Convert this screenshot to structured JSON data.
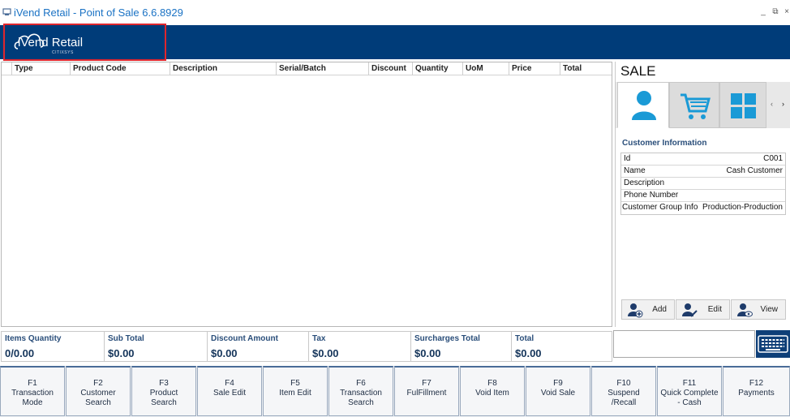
{
  "window": {
    "title": "iVend Retail - Point of Sale 6.6.8929"
  },
  "brand": {
    "name": "iVend Retail",
    "tagline": "CITIXSYS",
    "header_color": "#003c79"
  },
  "grid": {
    "columns": [
      "Type",
      "Product Code",
      "Description",
      "Serial/Batch",
      "Discount",
      "Quantity",
      "UoM",
      "Price",
      "Total"
    ]
  },
  "sale_panel": {
    "title": "SALE",
    "tabs": [
      {
        "icon": "customer-icon",
        "active": true
      },
      {
        "icon": "cart-icon",
        "active": false
      },
      {
        "icon": "grid-icon",
        "active": false
      }
    ],
    "customer_section_title": "Customer Information",
    "customer_fields": [
      {
        "label": "Id",
        "value": "C001"
      },
      {
        "label": "Name",
        "value": "Cash Customer"
      },
      {
        "label": "Description",
        "value": ""
      },
      {
        "label": "Phone Number",
        "value": ""
      },
      {
        "label": "Customer Group Info",
        "value": "Production-Production"
      }
    ],
    "actions": [
      {
        "label": "Add",
        "icon": "add-user-icon"
      },
      {
        "label": "Edit",
        "icon": "edit-user-icon"
      },
      {
        "label": "View",
        "icon": "view-user-icon"
      }
    ]
  },
  "totals": [
    {
      "label": "Items Quantity",
      "value": "0/0.00"
    },
    {
      "label": "Sub Total",
      "value": "$0.00"
    },
    {
      "label": "Discount Amount",
      "value": "$0.00"
    },
    {
      "label": "Tax",
      "value": "$0.00"
    },
    {
      "label": "Surcharges Total",
      "value": "$0.00"
    },
    {
      "label": "Total",
      "value": "$0.00"
    }
  ],
  "function_keys": [
    {
      "key": "F1",
      "line1": "Transaction",
      "line2": "Mode"
    },
    {
      "key": "F2",
      "line1": "Customer",
      "line2": "Search"
    },
    {
      "key": "F3",
      "line1": "Product",
      "line2": "Search"
    },
    {
      "key": "F4",
      "line1": "Sale Edit",
      "line2": ""
    },
    {
      "key": "F5",
      "line1": "Item Edit",
      "line2": ""
    },
    {
      "key": "F6",
      "line1": "Transaction",
      "line2": "Search"
    },
    {
      "key": "F7",
      "line1": "FulFillment",
      "line2": ""
    },
    {
      "key": "F8",
      "line1": "Void Item",
      "line2": ""
    },
    {
      "key": "F9",
      "line1": "Void Sale",
      "line2": ""
    },
    {
      "key": "F10",
      "line1": "Suspend",
      "line2": "/Recall"
    },
    {
      "key": "F11",
      "line1": "Quick Complete",
      "line2": "- Cash"
    },
    {
      "key": "F12",
      "line1": "Payments",
      "line2": ""
    }
  ],
  "colors": {
    "accent_blue": "#1a9ad6",
    "label_blue": "#2a4e7a",
    "highlight_red": "#e0262d"
  }
}
